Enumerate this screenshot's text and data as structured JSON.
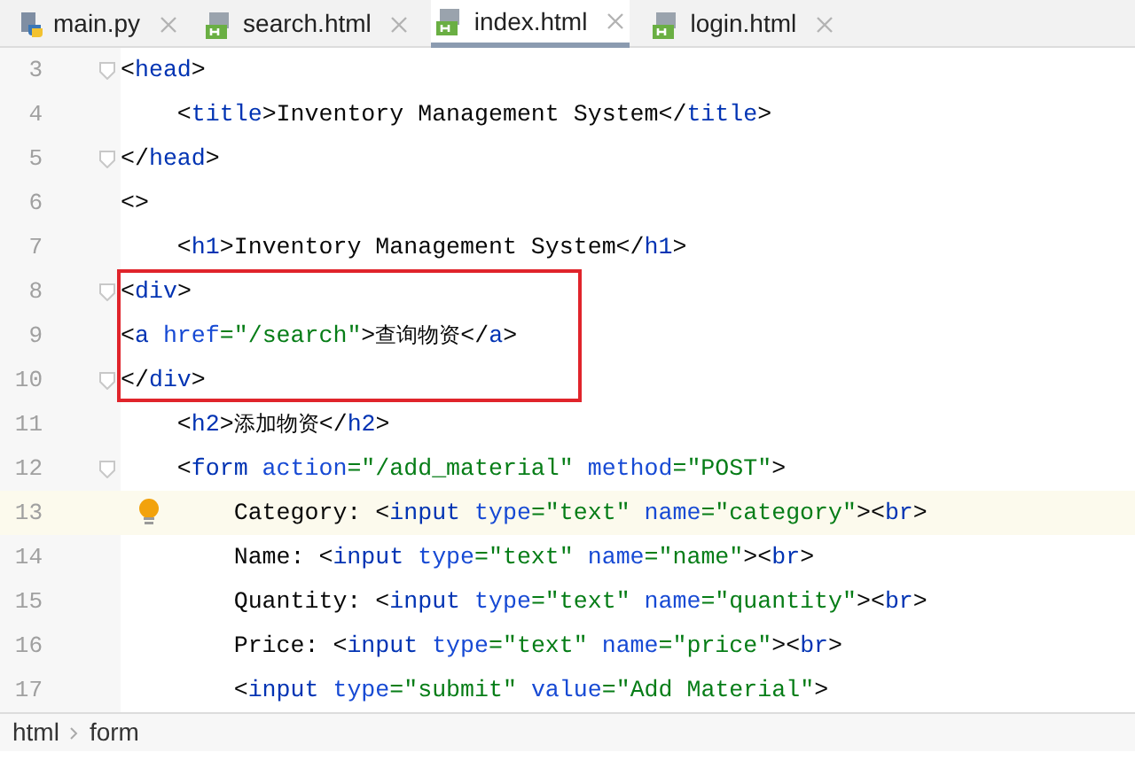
{
  "tabs": [
    {
      "label": "main.py",
      "kind": "python",
      "selected": false
    },
    {
      "label": "search.html",
      "kind": "html",
      "selected": false
    },
    {
      "label": "index.html",
      "kind": "html",
      "selected": true
    },
    {
      "label": "login.html",
      "kind": "html",
      "selected": false
    }
  ],
  "lines": [
    {
      "number": "3",
      "fold": true,
      "current": false,
      "boxed": false,
      "tokens": [
        {
          "kind": "p",
          "text": "<"
        },
        {
          "kind": "tag",
          "text": "head"
        },
        {
          "kind": "p",
          "text": ">"
        }
      ]
    },
    {
      "number": "4",
      "fold": false,
      "current": false,
      "boxed": false,
      "tokens": [
        {
          "kind": "p",
          "text": "    <"
        },
        {
          "kind": "tag",
          "text": "title"
        },
        {
          "kind": "p",
          "text": ">Inventory Management System</"
        },
        {
          "kind": "tag",
          "text": "title"
        },
        {
          "kind": "p",
          "text": ">"
        }
      ]
    },
    {
      "number": "5",
      "fold": true,
      "current": false,
      "boxed": false,
      "tokens": [
        {
          "kind": "p",
          "text": "</"
        },
        {
          "kind": "tag",
          "text": "head"
        },
        {
          "kind": "p",
          "text": ">"
        }
      ]
    },
    {
      "number": "6",
      "fold": false,
      "current": false,
      "boxed": false,
      "tokens": [
        {
          "kind": "p",
          "text": "<>"
        }
      ]
    },
    {
      "number": "7",
      "fold": false,
      "current": false,
      "boxed": false,
      "tokens": [
        {
          "kind": "p",
          "text": "    <"
        },
        {
          "kind": "tag",
          "text": "h1"
        },
        {
          "kind": "p",
          "text": ">Inventory Management System</"
        },
        {
          "kind": "tag",
          "text": "h1"
        },
        {
          "kind": "p",
          "text": ">"
        }
      ]
    },
    {
      "number": "8",
      "fold": true,
      "current": false,
      "boxed": true,
      "tokens": [
        {
          "kind": "p",
          "text": "<"
        },
        {
          "kind": "tag",
          "text": "div"
        },
        {
          "kind": "p",
          "text": ">"
        }
      ]
    },
    {
      "number": "9",
      "fold": false,
      "current": false,
      "boxed": true,
      "tokens": [
        {
          "kind": "p",
          "text": "<"
        },
        {
          "kind": "tag",
          "text": "a"
        },
        {
          "kind": "attr",
          "text": " href"
        },
        {
          "kind": "str",
          "text": "=\"/search\""
        },
        {
          "kind": "p",
          "text": ">"
        },
        {
          "kind": "cjk",
          "text": "查询物资"
        },
        {
          "kind": "p",
          "text": "</"
        },
        {
          "kind": "tag",
          "text": "a"
        },
        {
          "kind": "p",
          "text": ">"
        }
      ]
    },
    {
      "number": "10",
      "fold": true,
      "current": false,
      "boxed": true,
      "tokens": [
        {
          "kind": "p",
          "text": "</"
        },
        {
          "kind": "tag",
          "text": "div"
        },
        {
          "kind": "p",
          "text": ">"
        }
      ]
    },
    {
      "number": "11",
      "fold": false,
      "current": false,
      "boxed": false,
      "tokens": [
        {
          "kind": "p",
          "text": "    <"
        },
        {
          "kind": "tag",
          "text": "h2"
        },
        {
          "kind": "p",
          "text": ">"
        },
        {
          "kind": "cjk",
          "text": "添加物资"
        },
        {
          "kind": "p",
          "text": "</"
        },
        {
          "kind": "tag",
          "text": "h2"
        },
        {
          "kind": "p",
          "text": ">"
        }
      ]
    },
    {
      "number": "12",
      "fold": true,
      "current": false,
      "boxed": false,
      "tokens": [
        {
          "kind": "p",
          "text": "    <"
        },
        {
          "kind": "tag",
          "text": "form"
        },
        {
          "kind": "attr",
          "text": " action"
        },
        {
          "kind": "str",
          "text": "=\"/add_material\""
        },
        {
          "kind": "attr",
          "text": " method"
        },
        {
          "kind": "str",
          "text": "=\"POST\""
        },
        {
          "kind": "p",
          "text": ">"
        }
      ]
    },
    {
      "number": "13",
      "fold": false,
      "current": true,
      "boxed": false,
      "tokens": [
        {
          "kind": "p",
          "text": "        Category: <"
        },
        {
          "kind": "tag",
          "text": "input"
        },
        {
          "kind": "attr",
          "text": " type"
        },
        {
          "kind": "str",
          "text": "=\"text\""
        },
        {
          "kind": "attr",
          "text": " name"
        },
        {
          "kind": "str",
          "text": "=\"category\""
        },
        {
          "kind": "p",
          "text": "><"
        },
        {
          "kind": "tag",
          "text": "br"
        },
        {
          "kind": "p",
          "text": ">"
        }
      ]
    },
    {
      "number": "14",
      "fold": false,
      "current": false,
      "boxed": false,
      "tokens": [
        {
          "kind": "p",
          "text": "        Name: <"
        },
        {
          "kind": "tag",
          "text": "input"
        },
        {
          "kind": "attr",
          "text": " type"
        },
        {
          "kind": "str",
          "text": "=\"text\""
        },
        {
          "kind": "attr",
          "text": " name"
        },
        {
          "kind": "str",
          "text": "=\"name\""
        },
        {
          "kind": "p",
          "text": "><"
        },
        {
          "kind": "tag",
          "text": "br"
        },
        {
          "kind": "p",
          "text": ">"
        }
      ]
    },
    {
      "number": "15",
      "fold": false,
      "current": false,
      "boxed": false,
      "tokens": [
        {
          "kind": "p",
          "text": "        Quantity: <"
        },
        {
          "kind": "tag",
          "text": "input"
        },
        {
          "kind": "attr",
          "text": " type"
        },
        {
          "kind": "str",
          "text": "=\"text\""
        },
        {
          "kind": "attr",
          "text": " name"
        },
        {
          "kind": "str",
          "text": "=\"quantity\""
        },
        {
          "kind": "p",
          "text": "><"
        },
        {
          "kind": "tag",
          "text": "br"
        },
        {
          "kind": "p",
          "text": ">"
        }
      ]
    },
    {
      "number": "16",
      "fold": false,
      "current": false,
      "boxed": false,
      "tokens": [
        {
          "kind": "p",
          "text": "        Price: <"
        },
        {
          "kind": "tag",
          "text": "input"
        },
        {
          "kind": "attr",
          "text": " type"
        },
        {
          "kind": "str",
          "text": "=\"text\""
        },
        {
          "kind": "attr",
          "text": " name"
        },
        {
          "kind": "str",
          "text": "=\"price\""
        },
        {
          "kind": "p",
          "text": "><"
        },
        {
          "kind": "tag",
          "text": "br"
        },
        {
          "kind": "p",
          "text": ">"
        }
      ]
    },
    {
      "number": "17",
      "fold": false,
      "current": false,
      "boxed": false,
      "tokens": [
        {
          "kind": "p",
          "text": "        <"
        },
        {
          "kind": "tag",
          "text": "input"
        },
        {
          "kind": "attr",
          "text": " type"
        },
        {
          "kind": "str",
          "text": "=\"submit\""
        },
        {
          "kind": "attr",
          "text": " value"
        },
        {
          "kind": "str",
          "text": "=\"Add Material\""
        },
        {
          "kind": "p",
          "text": ">"
        }
      ]
    }
  ],
  "breadcrumbs": [
    "html",
    "form"
  ]
}
